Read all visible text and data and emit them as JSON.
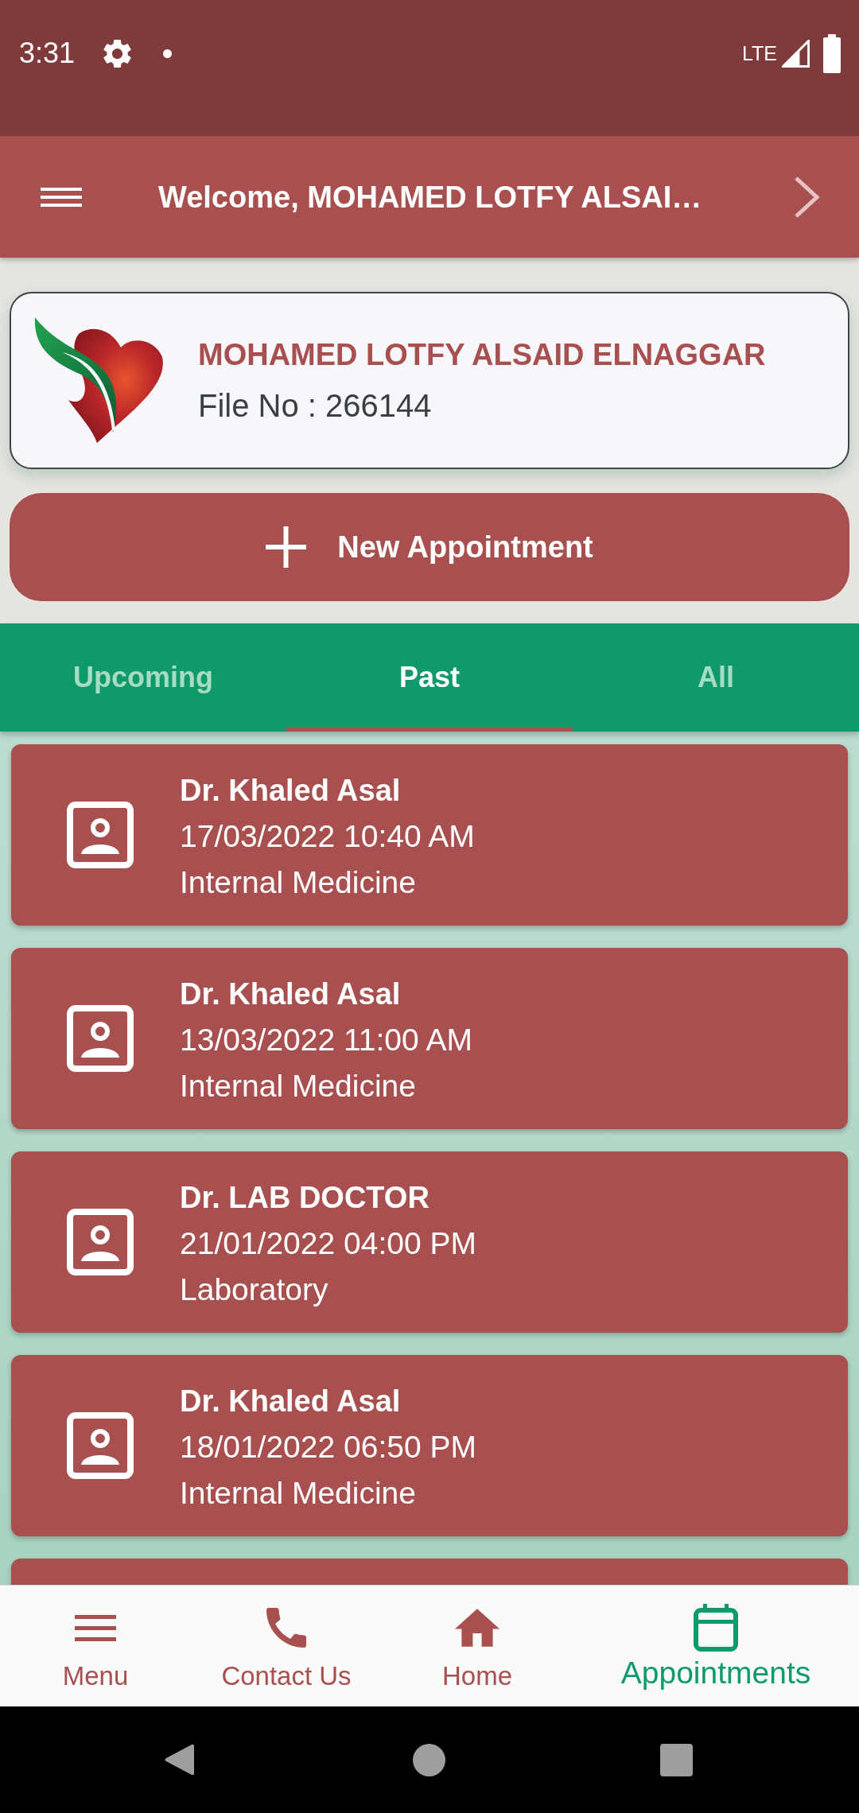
{
  "status_bar": {
    "time": "3:31",
    "network": "LTE"
  },
  "app_bar": {
    "title": "Welcome, MOHAMED LOTFY ALSAI…"
  },
  "profile": {
    "name": "MOHAMED LOTFY ALSAID ELNAGGAR",
    "file_no": "File No : 266144"
  },
  "new_appointment": {
    "label": "New Appointment"
  },
  "tabs": [
    {
      "label": "Upcoming",
      "selected": false
    },
    {
      "label": "Past",
      "selected": true
    },
    {
      "label": "All",
      "selected": false
    }
  ],
  "appointments": {
    "items": [
      {
        "doctor": "Dr. Khaled Asal",
        "datetime": "17/03/2022 10:40 AM",
        "department": "Internal Medicine"
      },
      {
        "doctor": "Dr. Khaled Asal",
        "datetime": "13/03/2022 11:00 AM",
        "department": "Internal Medicine"
      },
      {
        "doctor": "Dr. LAB DOCTOR",
        "datetime": "21/01/2022 04:00 PM",
        "department": "Laboratory"
      },
      {
        "doctor": "Dr. Khaled Asal",
        "datetime": "18/01/2022 06:50 PM",
        "department": "Internal Medicine"
      }
    ],
    "more_below": true
  },
  "bottom_nav": [
    {
      "label": "Menu",
      "selected": false
    },
    {
      "label": "Contact Us",
      "selected": false
    },
    {
      "label": "Home",
      "selected": false
    },
    {
      "label": "Appointments",
      "selected": true
    }
  ]
}
